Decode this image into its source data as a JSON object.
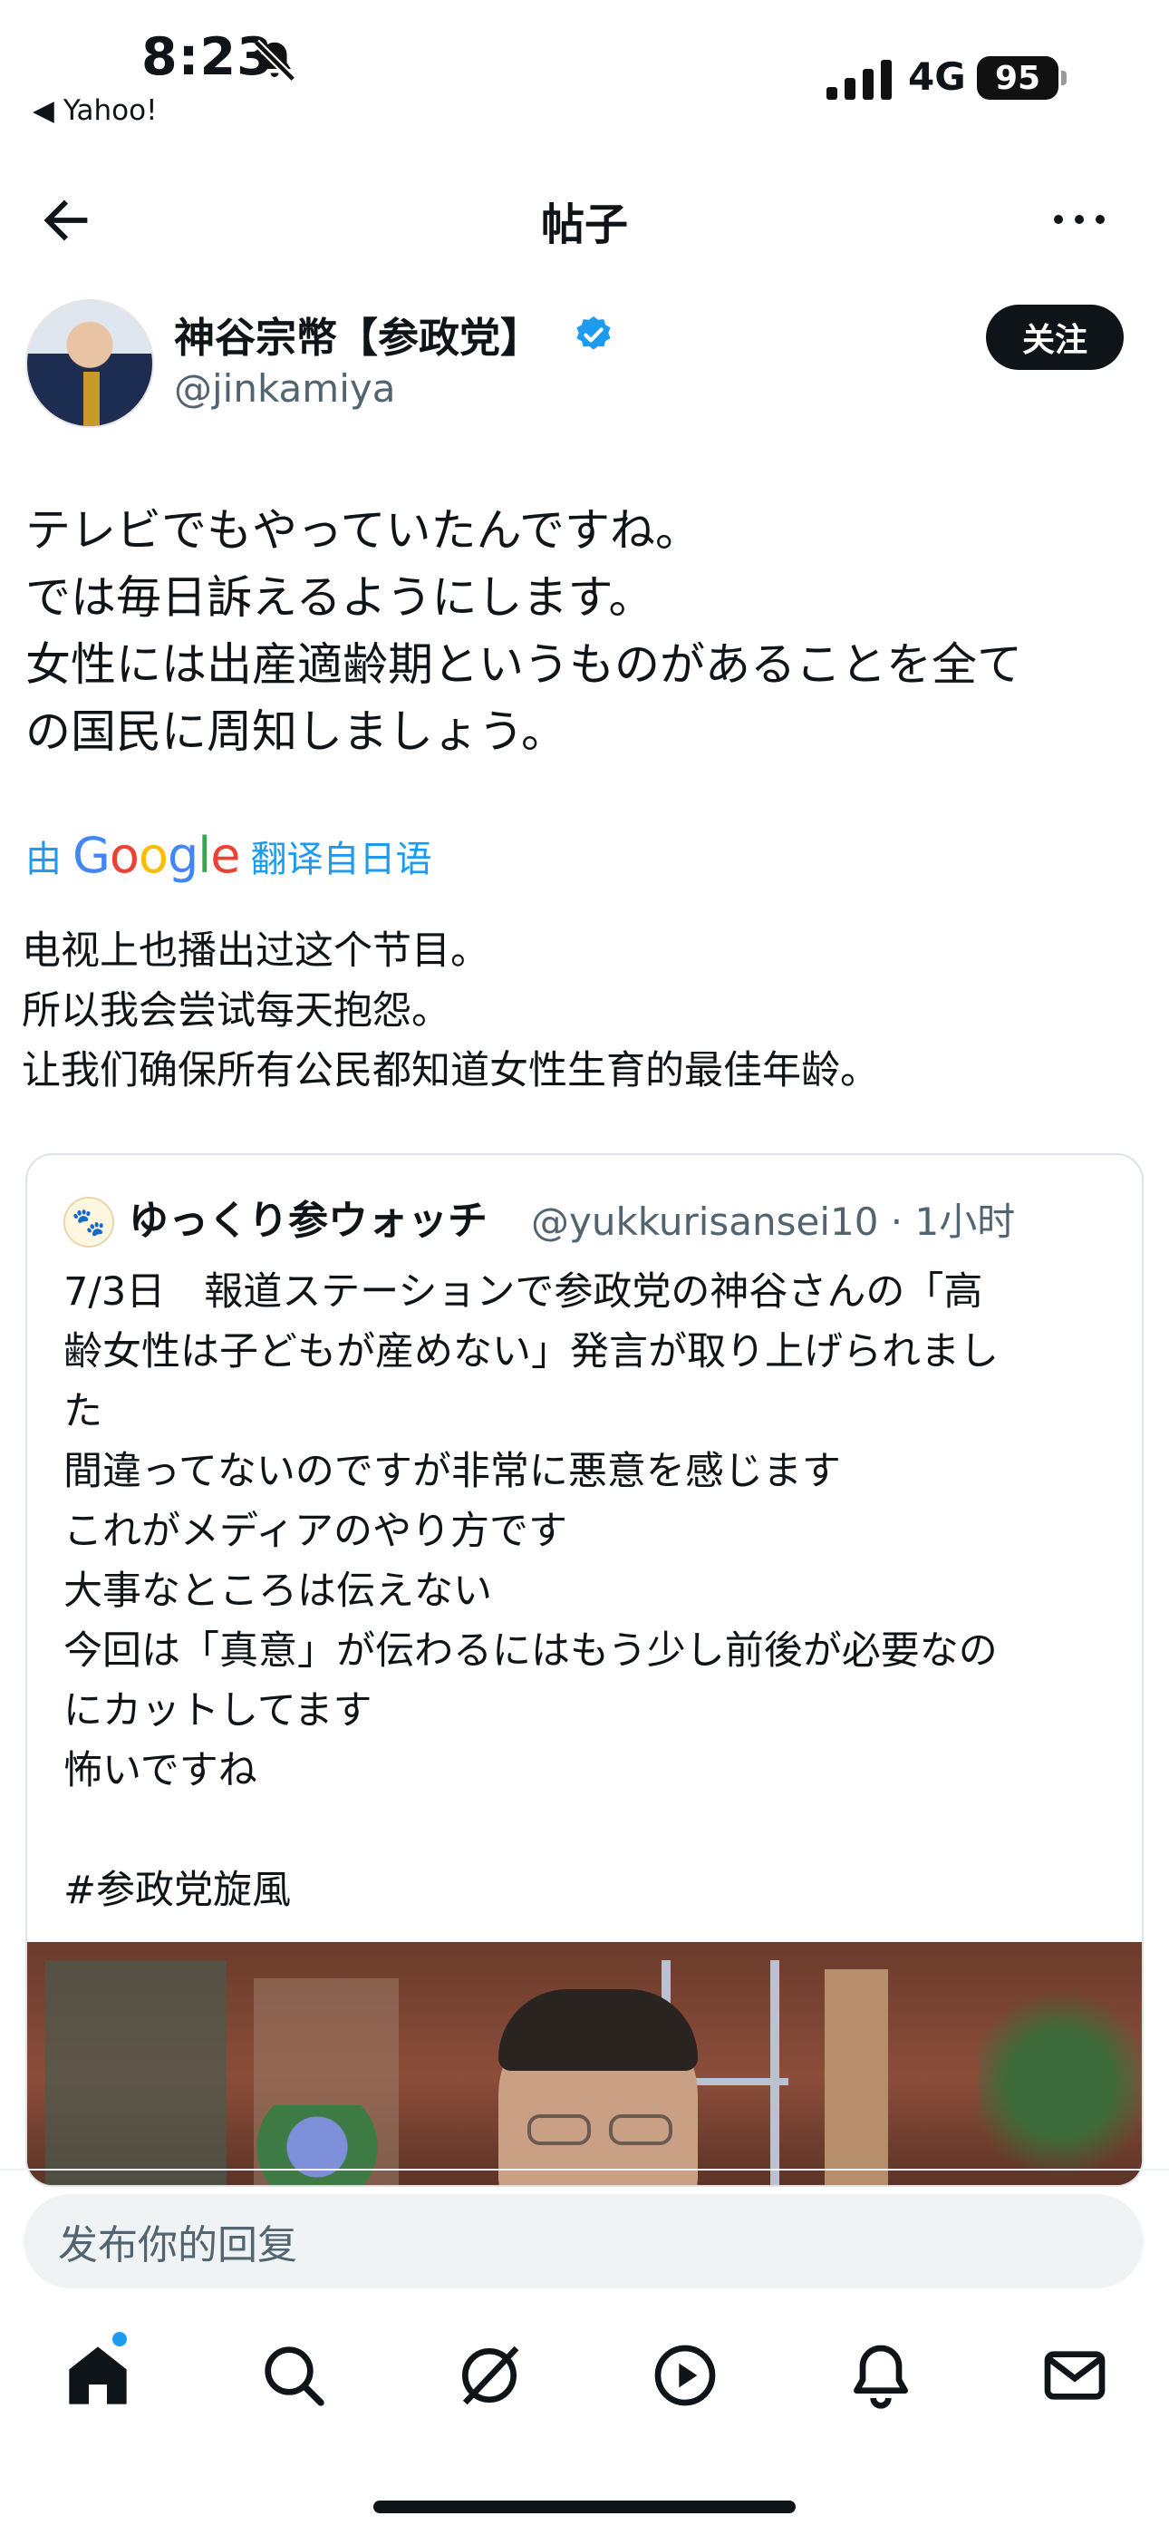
{
  "status_bar": {
    "time": "8:23",
    "back_app": "Yahoo!",
    "network": "4G",
    "battery": "95"
  },
  "header": {
    "title": "帖子"
  },
  "author": {
    "name": "神谷宗幣【参政党】",
    "handle": "@jinkamiya",
    "follow_label": "关注"
  },
  "tweet": {
    "lines": [
      "テレビでもやっていたんですね。",
      "では毎日訴えるようにします。",
      "女性には出産適齢期というものがあることを全て",
      "の国民に周知しましょう。"
    ]
  },
  "translation": {
    "by": "由",
    "google": "Google",
    "from": "翻译自日语",
    "lines": [
      "电视上也播出过这个节目。",
      "所以我会尝试每天抱怨。",
      "让我们确保所有公民都知道女性生育的最佳年龄。"
    ]
  },
  "quote": {
    "author": "ゆっくり参ウォッチ",
    "meta": "@yukkurisansei10 · 1小时",
    "lines": [
      "7/3日　報道ステーションで参政党の神谷さんの「高",
      "齢女性は子どもが産めない」発言が取り上げられまし",
      "た",
      "間違ってないのですが非常に悪意を感じます",
      "これがメディアのやり方です",
      "大事なところは伝えない",
      "今回は「真意」が伝わるにはもう少し前後が必要なの",
      "にカットしてます",
      "怖いですね",
      "",
      "#参政党旋風"
    ]
  },
  "reply": {
    "placeholder": "发布你的回复"
  },
  "tabs": [
    "home-icon",
    "search-icon",
    "grok-icon",
    "video-icon",
    "notifications-icon",
    "messages-icon"
  ],
  "colors": {
    "accent": "#1d9bf0",
    "text": "#0f1419",
    "secondary": "#536471"
  }
}
